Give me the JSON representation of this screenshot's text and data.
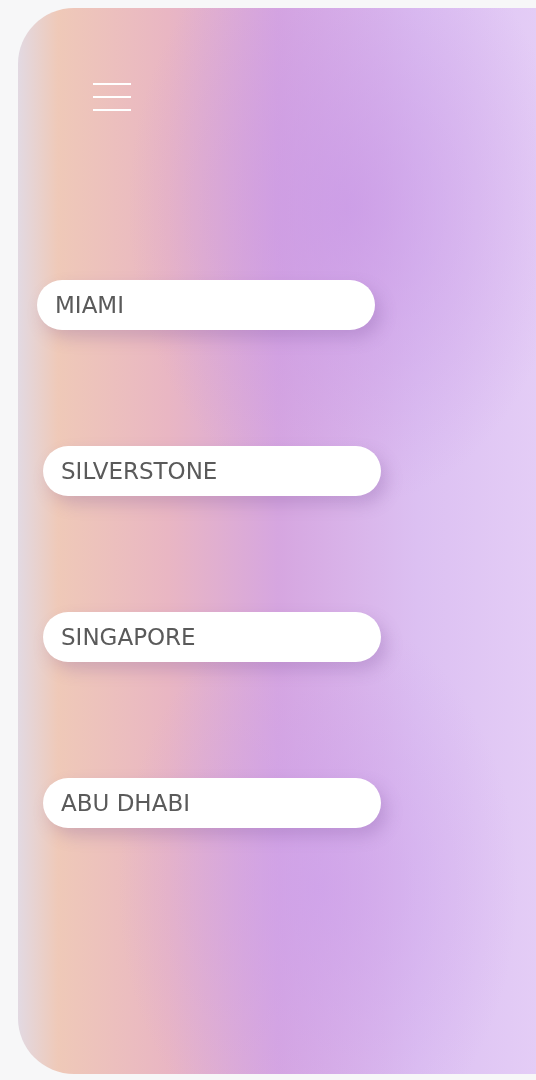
{
  "menu": {
    "items": [
      {
        "label": "MIAMI"
      },
      {
        "label": "SILVERSTONE"
      },
      {
        "label": "SINGAPORE"
      },
      {
        "label": "ABU DHABI"
      }
    ]
  }
}
